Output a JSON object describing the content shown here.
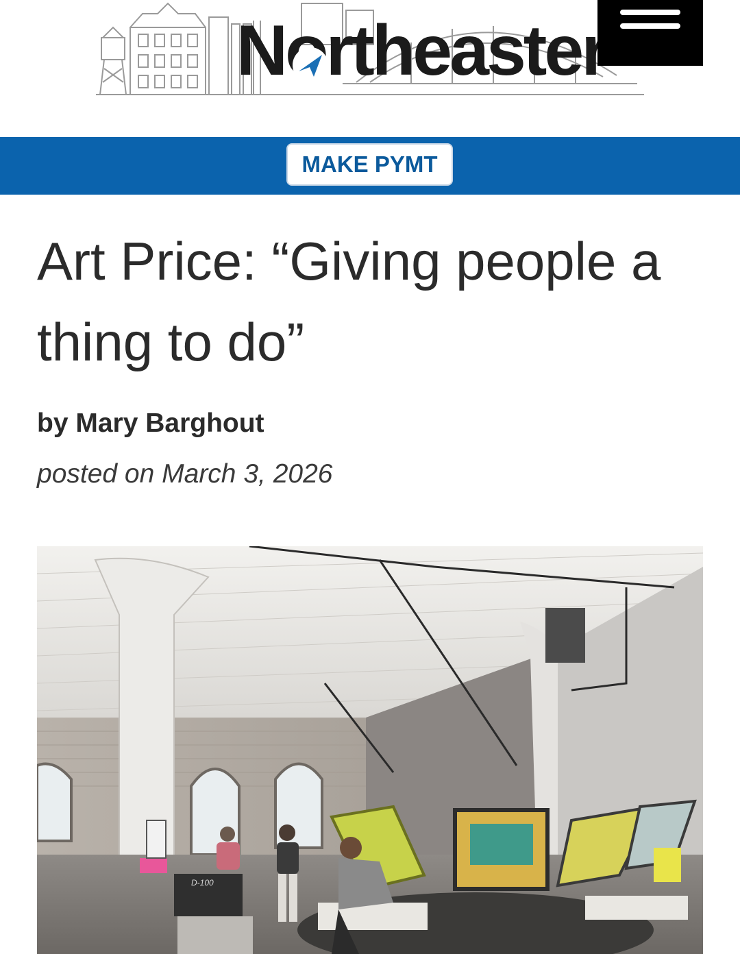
{
  "masthead": {
    "logo_text": "Northeaster",
    "menu_icon": "hamburger-menu-icon"
  },
  "nav": {
    "pay_label": "MAKE PYMT"
  },
  "article": {
    "headline": "Art Price: “Giving people a thing to do”",
    "byline": "by Mary Barghout",
    "posted": "posted on March 3, 2026"
  },
  "photo": {
    "machine_label": "D-100",
    "description_icon": "print-studio-photo"
  },
  "colors": {
    "brand_blue": "#0b63ad",
    "button_text": "#0b5a9c",
    "headline": "#2b2b2b"
  }
}
